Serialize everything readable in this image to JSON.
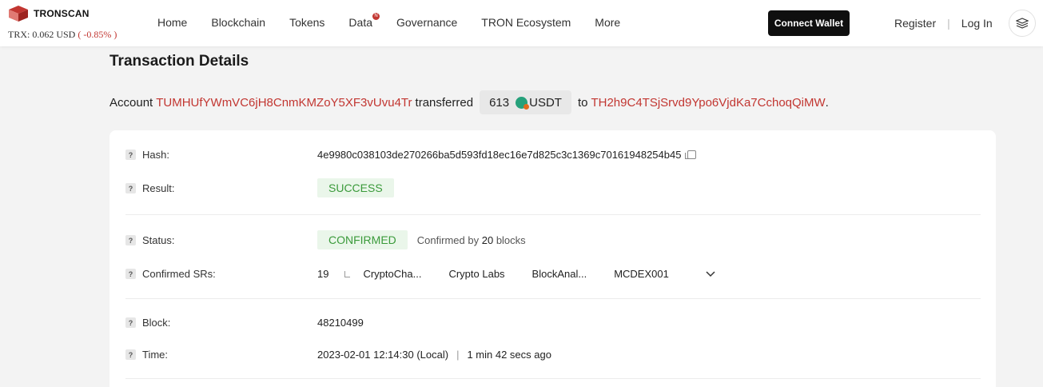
{
  "brand": {
    "name": "TRONSCAN"
  },
  "price": {
    "label": "TRX: 0.062 USD",
    "change": "( -0.85% )"
  },
  "nav": {
    "items": [
      "Home",
      "Blockchain",
      "Tokens",
      "Data",
      "Governance",
      "TRON Ecosystem",
      "More"
    ],
    "badge": "N"
  },
  "header": {
    "connect_label": "Connect Wallet",
    "register_label": "Register",
    "separator": "|",
    "login_label": "Log In"
  },
  "page": {
    "title": "Transaction Details"
  },
  "summary": {
    "prefix": "Account",
    "from": "TUMHUfYWmVC6jH8CnmKMZoY5XF3vUvu4Tr",
    "verb": "transferred",
    "amount": "613",
    "token": "USDT",
    "to_word": "to",
    "to": "TH2h9C4TSjSrvd9Ypo6VjdKa7CchoqQiMW",
    "end": "."
  },
  "details": {
    "hash_label": "Hash:",
    "hash_value": "4e9980c038103de270266ba5d593fd18ec16e7d825c3c1369c70161948254b45",
    "result_label": "Result:",
    "result_value": "SUCCESS",
    "status_label": "Status:",
    "status_value": "CONFIRMED",
    "status_note_prefix": "Confirmed by",
    "status_blocks": "20",
    "status_note_suffix": "blocks",
    "srs_label": "Confirmed SRs:",
    "srs_count": "19",
    "srs": [
      "CryptoCha...",
      "Crypto Labs",
      "BlockAnal...",
      "MCDEX001"
    ],
    "block_label": "Block:",
    "block_value": "48210499",
    "time_label": "Time:",
    "time_value": "2023-02-01 12:14:30 (Local)",
    "time_sep": "|",
    "time_ago": "1 min 42 secs ago"
  },
  "colors": {
    "accent": "#c23631",
    "success_bg": "#eaf6ea",
    "success_text": "#3a9a3a"
  }
}
